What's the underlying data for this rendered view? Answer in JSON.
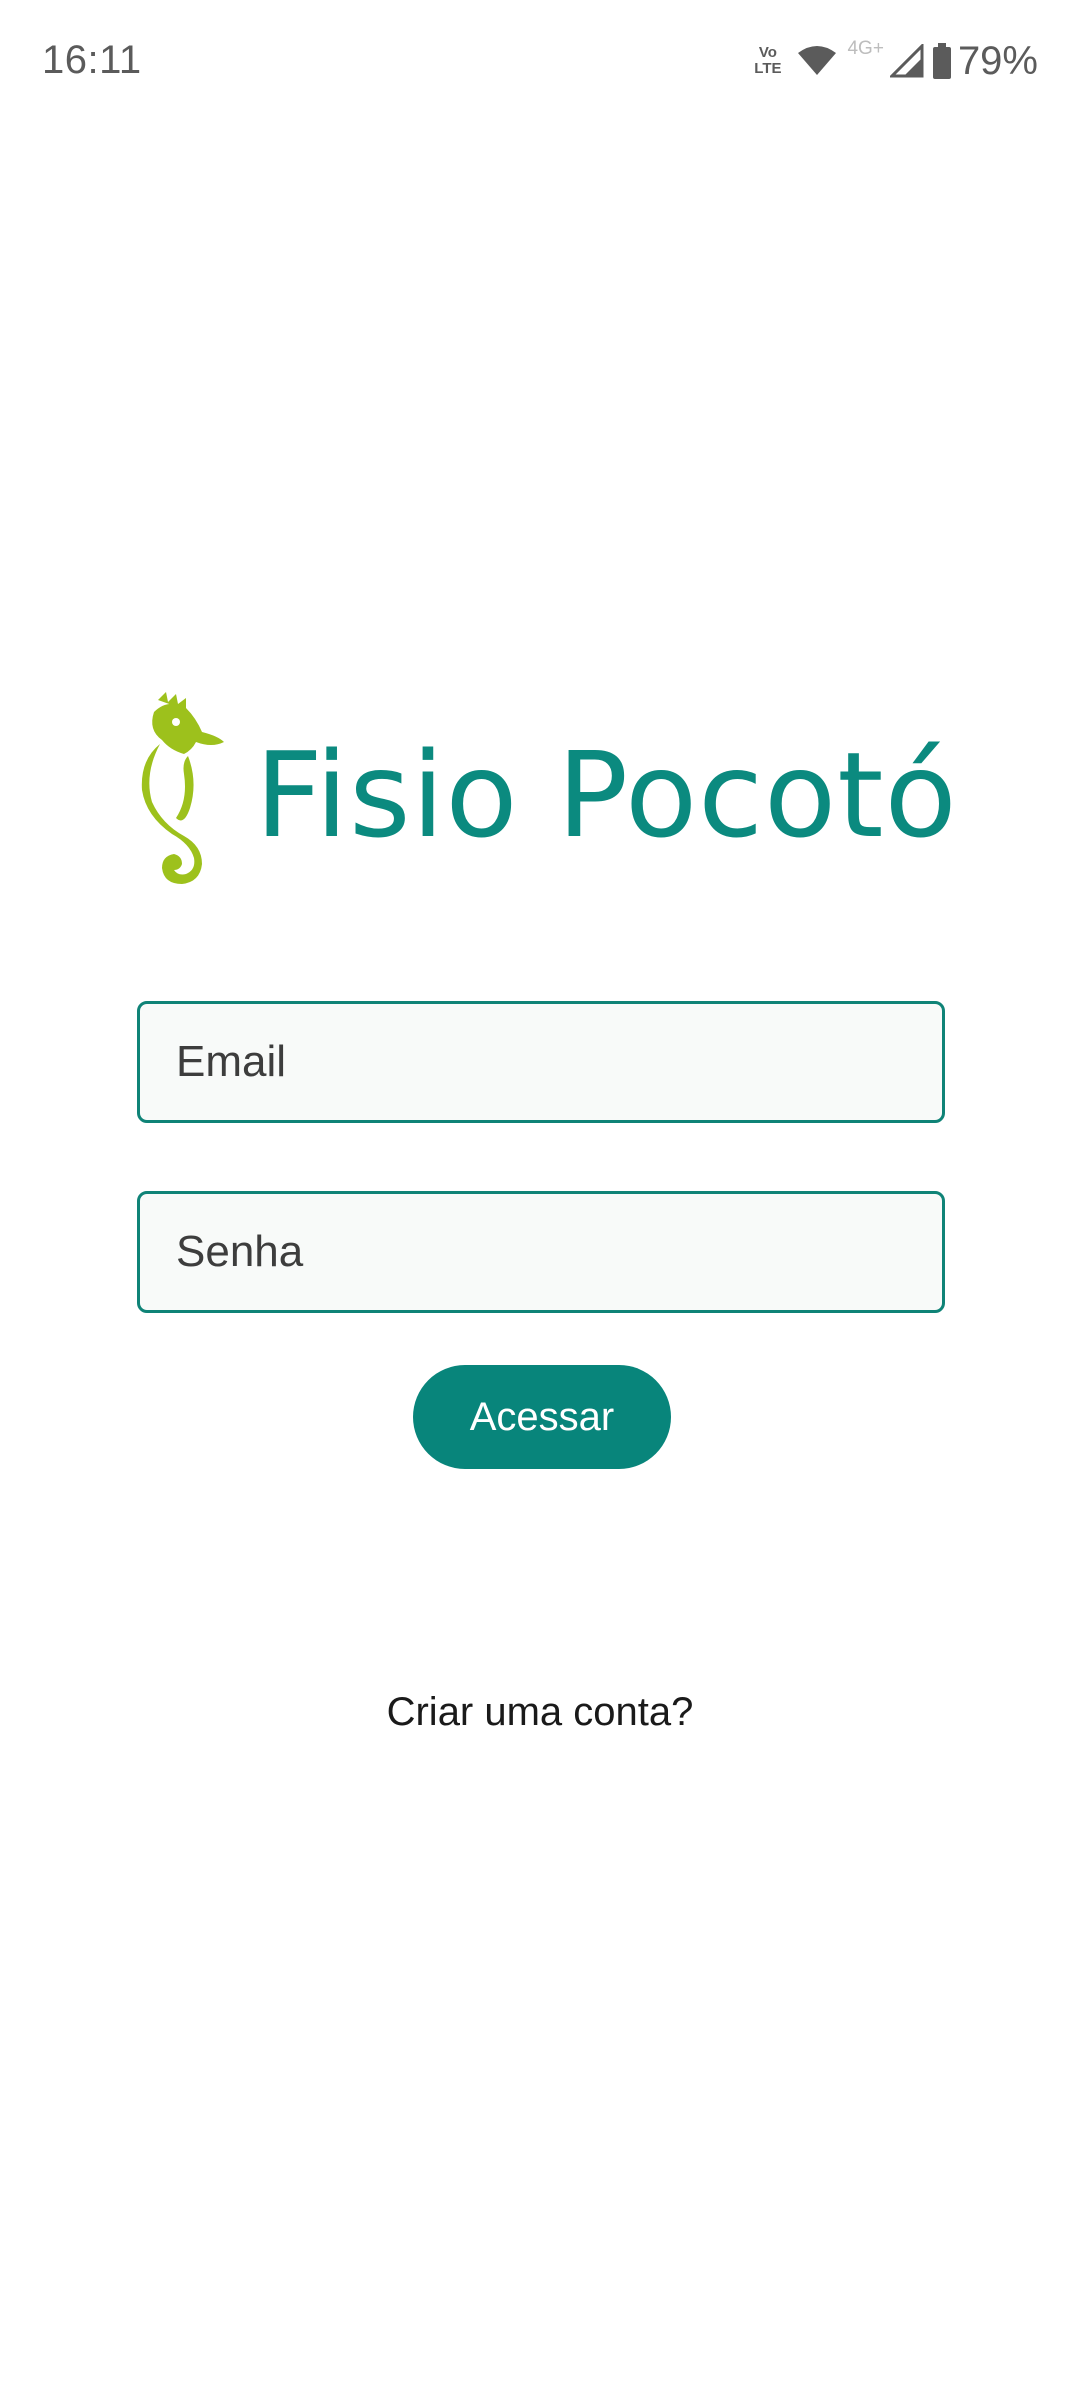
{
  "status_bar": {
    "time": "16:11",
    "volte_top": "Vo",
    "volte_bottom": "LTE",
    "network_type": "4G+",
    "battery": "79%",
    "icons": [
      "volte-icon",
      "wifi-icon",
      "signal-icon",
      "battery-icon"
    ]
  },
  "logo": {
    "text": "Fisio Pocotó",
    "mark_icon": "seahorse-icon"
  },
  "login": {
    "email_placeholder": "Email",
    "email_value": "",
    "password_placeholder": "Senha",
    "password_value": "",
    "submit_label": "Acessar",
    "create_account_label": "Criar uma conta?"
  },
  "colors": {
    "brand_teal": "#0b8a7f",
    "button_teal": "#08857b",
    "seahorse_green": "#9dc11c",
    "field_border": "#0f8377",
    "field_background": "#f8faf9"
  }
}
